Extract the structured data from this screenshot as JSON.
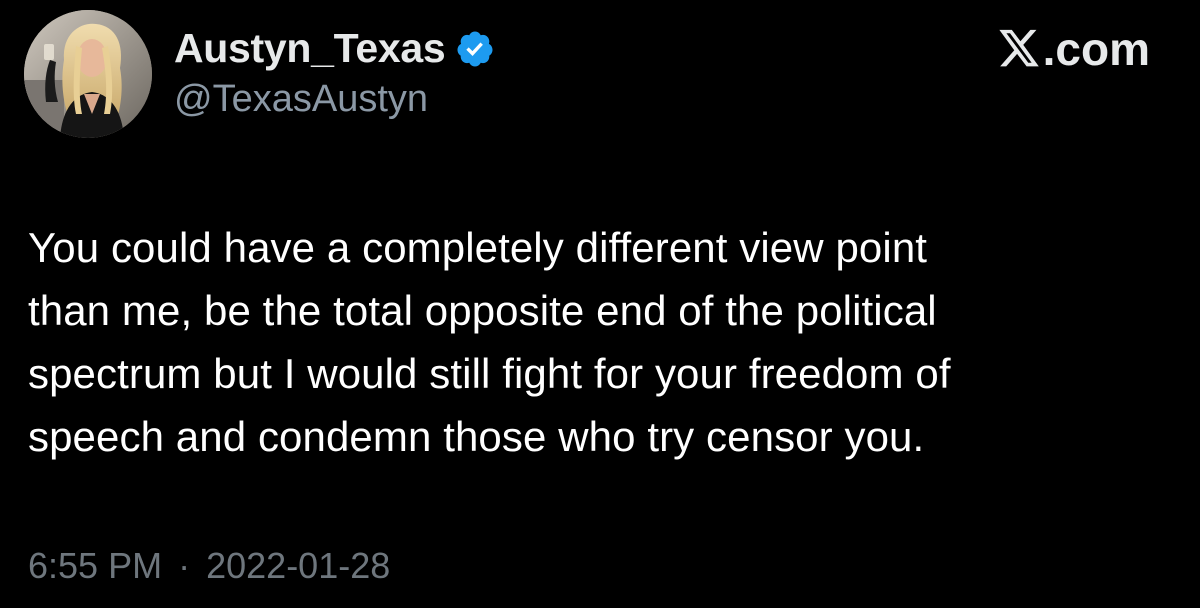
{
  "author": {
    "display_name": "Austyn_Texas",
    "handle": "@TexasAustyn",
    "verified": true,
    "verified_color": "#1d9bf0",
    "avatar_icon": "profile-photo"
  },
  "brand": {
    "label": ".com",
    "logo_icon": "x-logo-icon"
  },
  "tweet": {
    "lines": [
      "You could have a completely different view point",
      "than me, be the total opposite end of the political",
      "spectrum but I would still fight for your freedom of",
      "speech and condemn those who try censor you."
    ]
  },
  "meta": {
    "time": "6:55 PM",
    "separator": "·",
    "date": "2022-01-28"
  },
  "colors": {
    "background": "#000000",
    "text": "#e7e9ea",
    "secondary_text": "#8b98a5",
    "muted_text": "#6e767d"
  }
}
